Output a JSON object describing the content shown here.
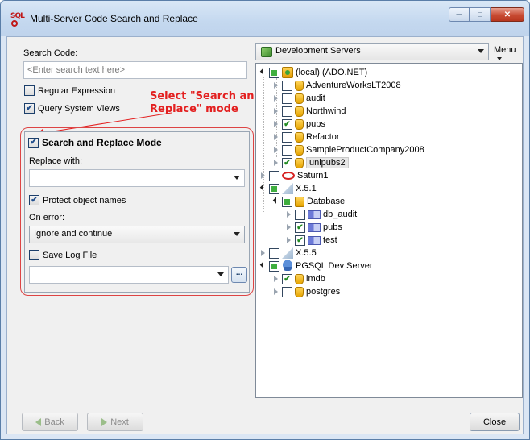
{
  "window": {
    "title": "Multi-Server Code Search and Replace",
    "app_icon_text": "SQL",
    "icons": {
      "minimize": "minimize-icon",
      "maximize": "maximize-icon",
      "close": "close-icon"
    }
  },
  "search": {
    "label": "Search Code:",
    "placeholder": "<Enter search text here>",
    "regex_label": "Regular Expression",
    "regex_checked": false,
    "query_views_label": "Query System Views",
    "query_views_checked": true
  },
  "annotation": {
    "line1": "Select \"Search and",
    "line2": "Replace\" mode",
    "color": "#e32020"
  },
  "replace": {
    "mode_label": "Search and Replace Mode",
    "mode_checked": true,
    "replace_with_label": "Replace with:",
    "replace_with_value": "",
    "protect_label": "Protect object names",
    "protect_checked": true,
    "on_error_label": "On error:",
    "on_error_value": "Ignore and continue",
    "save_log_label": "Save Log File",
    "save_log_checked": false,
    "log_path_value": "",
    "browse_label": "..."
  },
  "footer": {
    "back_label": "Back",
    "next_label": "Next",
    "close_label": "Close"
  },
  "servers": {
    "dropdown_value": "Development Servers",
    "menu_label": "Menu",
    "tree": {
      "local": {
        "label": "(local) (ADO.NET)",
        "state": "partial"
      },
      "local_dbs": [
        {
          "label": "AdventureWorksLT2008",
          "state": "unchecked"
        },
        {
          "label": "audit",
          "state": "unchecked"
        },
        {
          "label": "Northwind",
          "state": "unchecked"
        },
        {
          "label": "pubs",
          "state": "checked"
        },
        {
          "label": "Refactor",
          "state": "unchecked"
        },
        {
          "label": "SampleProductCompany2008",
          "state": "unchecked"
        },
        {
          "label": "unipubs2",
          "state": "checked"
        }
      ],
      "saturn": {
        "label": "Saturn1",
        "state": "unchecked"
      },
      "x51": {
        "label": "X.5.1",
        "state": "partial"
      },
      "database": {
        "label": "Database",
        "state": "partial"
      },
      "x51_schemas": [
        {
          "label": "db_audit",
          "state": "unchecked"
        },
        {
          "label": "pubs",
          "state": "checked"
        },
        {
          "label": "test",
          "state": "checked"
        }
      ],
      "x55": {
        "label": "X.5.5",
        "state": "unchecked"
      },
      "pgsql": {
        "label": "PGSQL Dev Server",
        "state": "partial"
      },
      "pg_dbs": [
        {
          "label": "imdb",
          "state": "checked"
        },
        {
          "label": "postgres",
          "state": "unchecked"
        }
      ]
    }
  }
}
